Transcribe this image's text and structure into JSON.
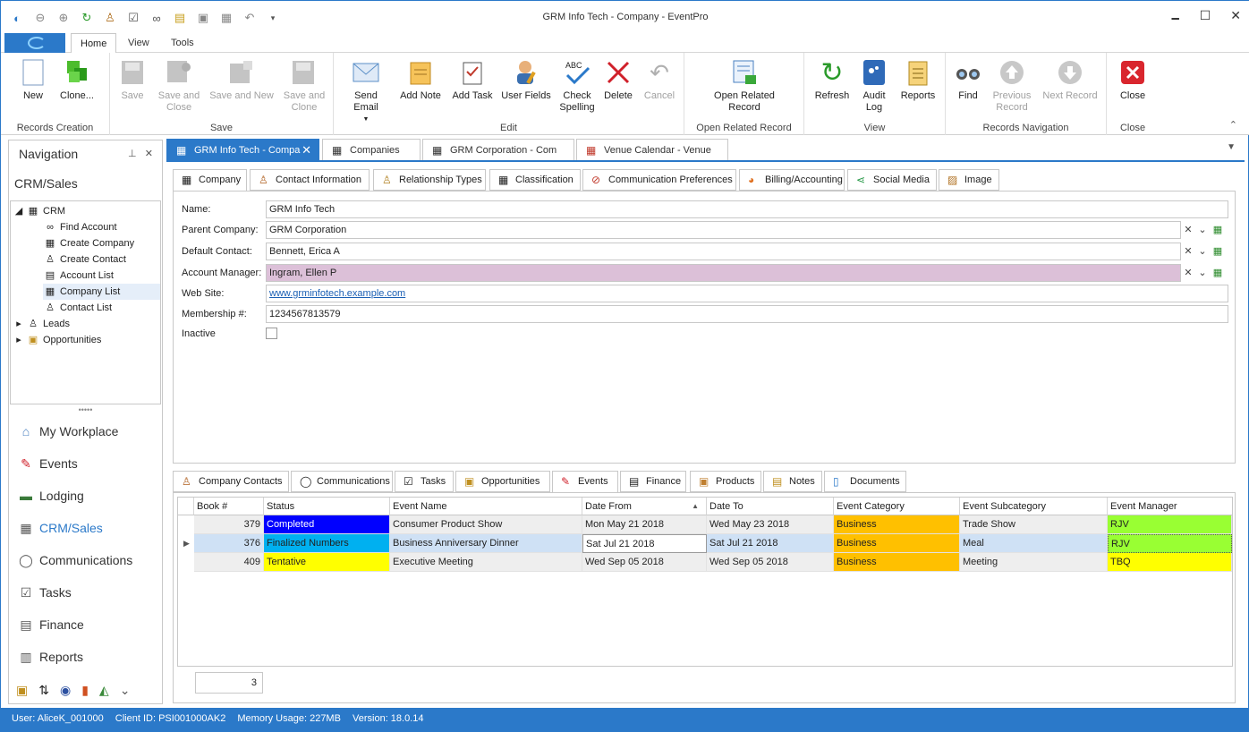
{
  "window": {
    "title": "GRM Info Tech - Company - EventPro",
    "minimize": "🗕",
    "maximize": "☐",
    "close": "✕"
  },
  "ribbon_tabs": [
    "Home",
    "View",
    "Tools"
  ],
  "ribbon": {
    "groups": {
      "records_creation": "Records Creation",
      "save": "Save",
      "edit": "Edit",
      "open_related": "Open Related Record",
      "view": "View",
      "records_nav": "Records Navigation",
      "close": "Close"
    },
    "buttons": {
      "new": "New",
      "clone": "Clone...",
      "save": "Save",
      "save_close": "Save and Close",
      "save_new": "Save and New",
      "save_clone": "Save and Clone",
      "send_email": "Send Email",
      "add_note": "Add Note",
      "add_task": "Add Task",
      "user_fields": "User Fields",
      "check_spelling": "Check Spelling",
      "delete": "Delete",
      "cancel": "Cancel",
      "open_related_record": "Open Related Record",
      "refresh": "Refresh",
      "audit_log": "Audit Log",
      "reports": "Reports",
      "find": "Find",
      "previous_record": "Previous Record",
      "next_record": "Next Record",
      "close": "Close"
    }
  },
  "navigation": {
    "header": "Navigation",
    "section": "CRM/Sales",
    "tree": {
      "crm": "CRM",
      "find_account": "Find Account",
      "create_company": "Create Company",
      "create_contact": "Create Contact",
      "account_list": "Account List",
      "company_list": "Company List",
      "contact_list": "Contact List",
      "leads": "Leads",
      "opportunities": "Opportunities"
    },
    "buttons": {
      "my_workplace": "My Workplace",
      "events": "Events",
      "lodging": "Lodging",
      "crm_sales": "CRM/Sales",
      "communications": "Communications",
      "tasks": "Tasks",
      "finance": "Finance",
      "reports": "Reports"
    }
  },
  "doc_tabs": [
    {
      "label": "GRM Info Tech - Compa",
      "active": true
    },
    {
      "label": "Companies"
    },
    {
      "label": "GRM Corporation - Com"
    },
    {
      "label": "Venue Calendar - Venue"
    }
  ],
  "record_tabs": {
    "company": "Company",
    "contact_information": "Contact Information",
    "relationship_types": "Relationship Types",
    "classification": "Classification",
    "communication_preferences": "Communication Preferences",
    "billing_accounting": "Billing/Accounting",
    "social_media": "Social Media",
    "image": "Image"
  },
  "form": {
    "name_label": "Name:",
    "name": "GRM Info Tech",
    "parent_label": "Parent Company:",
    "parent": "GRM Corporation",
    "contact_label": "Default Contact:",
    "contact": "Bennett, Erica A",
    "manager_label": "Account Manager:",
    "manager": "Ingram, Ellen P",
    "website_label": "Web Site:",
    "website": "www.grminfotech.example.com",
    "membership_label": "Membership #:",
    "membership": "1234567813579",
    "inactive_label": "Inactive"
  },
  "lower_tabs": {
    "company_contacts": "Company Contacts",
    "communications": "Communications",
    "tasks": "Tasks",
    "opportunities": "Opportunities",
    "events": "Events",
    "finance": "Finance",
    "products": "Products",
    "notes": "Notes",
    "documents": "Documents"
  },
  "grid": {
    "columns": {
      "book": "Book #",
      "status": "Status",
      "event_name": "Event Name",
      "date_from": "Date From",
      "date_to": "Date To",
      "event_category": "Event Category",
      "event_subcategory": "Event Subcategory",
      "event_manager": "Event Manager"
    },
    "rows": [
      {
        "book": "379",
        "status": "Completed",
        "event_name": "Consumer Product Show",
        "date_from": "Mon May 21 2018",
        "date_to": "Wed May 23 2018",
        "category": "Business",
        "subcategory": "Trade Show",
        "manager": "RJV"
      },
      {
        "book": "376",
        "status": "Finalized Numbers",
        "event_name": "Business Anniversary Dinner",
        "date_from": "Sat Jul 21 2018",
        "date_to": "Sat Jul 21 2018",
        "category": "Business",
        "subcategory": "Meal",
        "manager": "RJV"
      },
      {
        "book": "409",
        "status": "Tentative",
        "event_name": "Executive Meeting",
        "date_from": "Wed Sep 05 2018",
        "date_to": "Wed Sep 05 2018",
        "category": "Business",
        "subcategory": "Meeting",
        "manager": "TBQ"
      }
    ],
    "count": "3"
  },
  "colors": {
    "accent": "#2b79c9",
    "completed": "#0000ff",
    "finalized": "#00b0f0",
    "tentative": "#ffff00",
    "business": "#ffc000",
    "rjv": "#99ff33",
    "tbq": "#ffff00"
  },
  "statusbar": {
    "user": "User: AliceK_001000",
    "client": "Client ID: PSI001000AK2",
    "memory": "Memory Usage: 227MB",
    "version": "Version: 18.0.14"
  }
}
